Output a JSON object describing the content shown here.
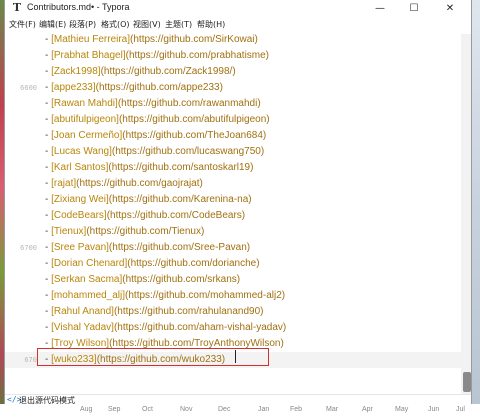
{
  "window": {
    "title": "Contributors.md• - Typora",
    "minimize": "—",
    "maximize": "☐",
    "close": "✕",
    "app_icon": "T"
  },
  "menu": [
    "文件(F)",
    "编辑(E)",
    "段落(P)",
    "格式(O)",
    "视图(V)",
    "主题(T)",
    "帮助(H)"
  ],
  "editor": {
    "lines": [
      {
        "gutter": "",
        "name": "[Mathieu Ferreira]",
        "url": "(https://github.com/SirKowai)"
      },
      {
        "gutter": "",
        "name": "[Prabhat Bhagel]",
        "url": "(https://github.com/prabhatisme)"
      },
      {
        "gutter": "",
        "name": "[Zack1998]",
        "url": "(https://github.com/Zack1998/)"
      },
      {
        "gutter": "6600",
        "name": "[appe233]",
        "url": "(https://github.com/appe233)"
      },
      {
        "gutter": "",
        "name": "[Rawan Mahdi]",
        "url": "(https://github.com/rawanmahdi)"
      },
      {
        "gutter": "",
        "name": "[abutifulpigeon]",
        "url": "(https://github.com/abutifulpigeon)"
      },
      {
        "gutter": "",
        "name": "[Joan Cermeño]",
        "url": "(https://github.com/TheJoan684)"
      },
      {
        "gutter": "",
        "name": "[Lucas Wang]",
        "url": "(https://github.com/lucaswang750)"
      },
      {
        "gutter": "",
        "name": "[Karl Santos]",
        "url": "(https://github.com/santoskarl19)"
      },
      {
        "gutter": "",
        "name": "[rajat]",
        "url": "(https://github.com/gaojrajat)"
      },
      {
        "gutter": "",
        "name": "[Zixiang Wei]",
        "url": "(https://github.com/Karenina-na)"
      },
      {
        "gutter": "",
        "name": "[CodeBears]",
        "url": "(https://github.com/CodeBears)"
      },
      {
        "gutter": "",
        "name": "[Tienux]",
        "url": "(https://github.com/Tienux)"
      },
      {
        "gutter": "6700",
        "name": "[Sree Pavan]",
        "url": "(https://github.com/Sree-Pavan)"
      },
      {
        "gutter": "",
        "name": "[Dorian Chenard]",
        "url": "(https://github.com/dorianche)"
      },
      {
        "gutter": "",
        "name": "[Serkan Sacma]",
        "url": "(https://github.com/srkans)"
      },
      {
        "gutter": "",
        "name": "[mohammed_alj]",
        "url": "(https://github.com/mohammed-alj2)"
      },
      {
        "gutter": "",
        "name": "[Rahul Anand]",
        "url": "(https://github.com/rahulanand90)"
      },
      {
        "gutter": "",
        "name": "[Vishal Yadav]",
        "url": "(https://github.com/aham-vishal-yadav)"
      },
      {
        "gutter": "",
        "name": "[Troy Wilson]",
        "url": "(https://github.com/TroyAnthonyWilson)"
      },
      {
        "gutter": "670",
        "name": "[wuko233]",
        "url": "(https://github.com/wuko233)"
      }
    ],
    "dash": "- "
  },
  "statusbar": {
    "source_icon": "</>",
    "source_label": "退出源代码模式"
  },
  "outer_axis": {
    "months": [
      "Aug",
      "Sep",
      "Oct",
      "Nov",
      "Dec",
      "Jan",
      "Feb",
      "Mar",
      "Apr",
      "May",
      "Jun",
      "Jul"
    ]
  },
  "colors": {
    "link_text": "#b8860b",
    "highlight_border": "#d32f2f",
    "current_line": "#f3f3f3"
  }
}
